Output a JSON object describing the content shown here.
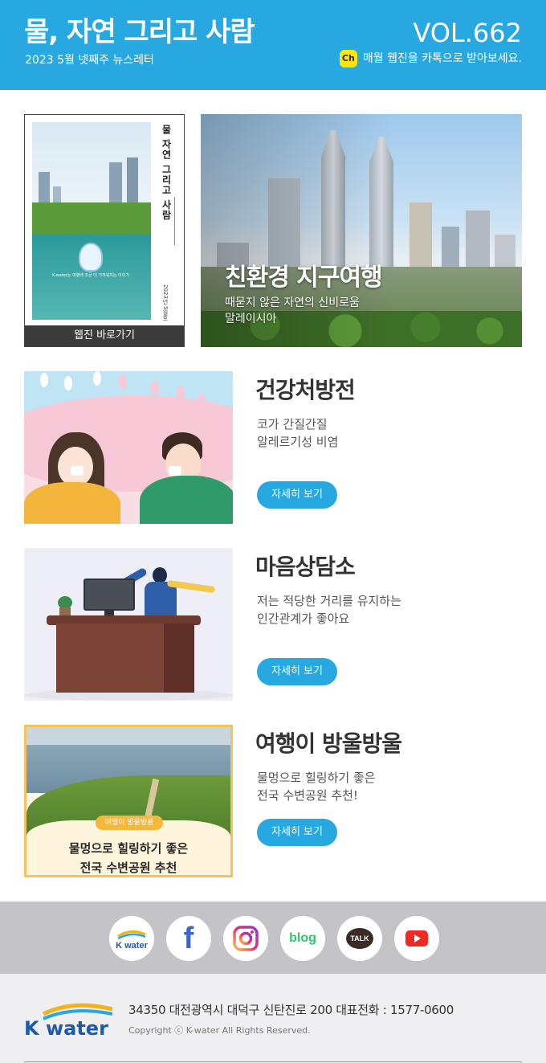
{
  "header": {
    "title": "물, 자연 그리고 사람",
    "subtitle": "2023 5월 넷째주 뉴스레터",
    "volume": "VOL.662",
    "kakao_icon_label": "Ch",
    "kakao_text": "매월 웹진을 카톡으로 받아보세요.",
    "background_color": "#27a8e0"
  },
  "webzine": {
    "cover_title": "물 자연 그리고 사람",
    "cover_date": "2023년 5월호",
    "cover_caption": "K-water는 여행에 조금 더 가까워지는 이야기",
    "link_label": "웹진 바로가기"
  },
  "feature": {
    "title": "친환경 지구여행",
    "line1": "때묻지 않은 자연의 신비로움",
    "line2": "말레이시아"
  },
  "articles": [
    {
      "title": "건강처방전",
      "desc_line1": "코가 간질간질",
      "desc_line2": "알레르기성 비염",
      "button": "자세히 보기"
    },
    {
      "title": "마음상담소",
      "desc_line1": "저는 적당한 거리를 유지하는",
      "desc_line2": "인간관계가 좋아요",
      "button": "자세히 보기"
    },
    {
      "title": "여행이 방울방울",
      "desc_line1": "물멍으로 힐링하기 좋은",
      "desc_line2": "전국 수변공원 추천!",
      "button": "자세히 보기",
      "thumb_badge": "여행이 방울방울",
      "thumb_line1": "물멍으로 힐링하기 좋은",
      "thumb_line2": "전국 수변공원 추천"
    }
  ],
  "sns": {
    "kwater": "K water",
    "facebook": "f",
    "instagram": "instagram-icon",
    "blog": "blog",
    "talk": "TALK",
    "youtube": "youtube-icon"
  },
  "footer": {
    "logo": "K water",
    "address": "34350 대전광역시 대덕구 신탄진로 200   대표전화 : 1577-0600",
    "copyright": "Copyright ⓒ K-water All Rights Reserved."
  },
  "colors": {
    "accent": "#27a8e0",
    "kakao": "#fde700",
    "footer_bg": "#efeff1",
    "sns_bg": "#c4c4c8"
  }
}
